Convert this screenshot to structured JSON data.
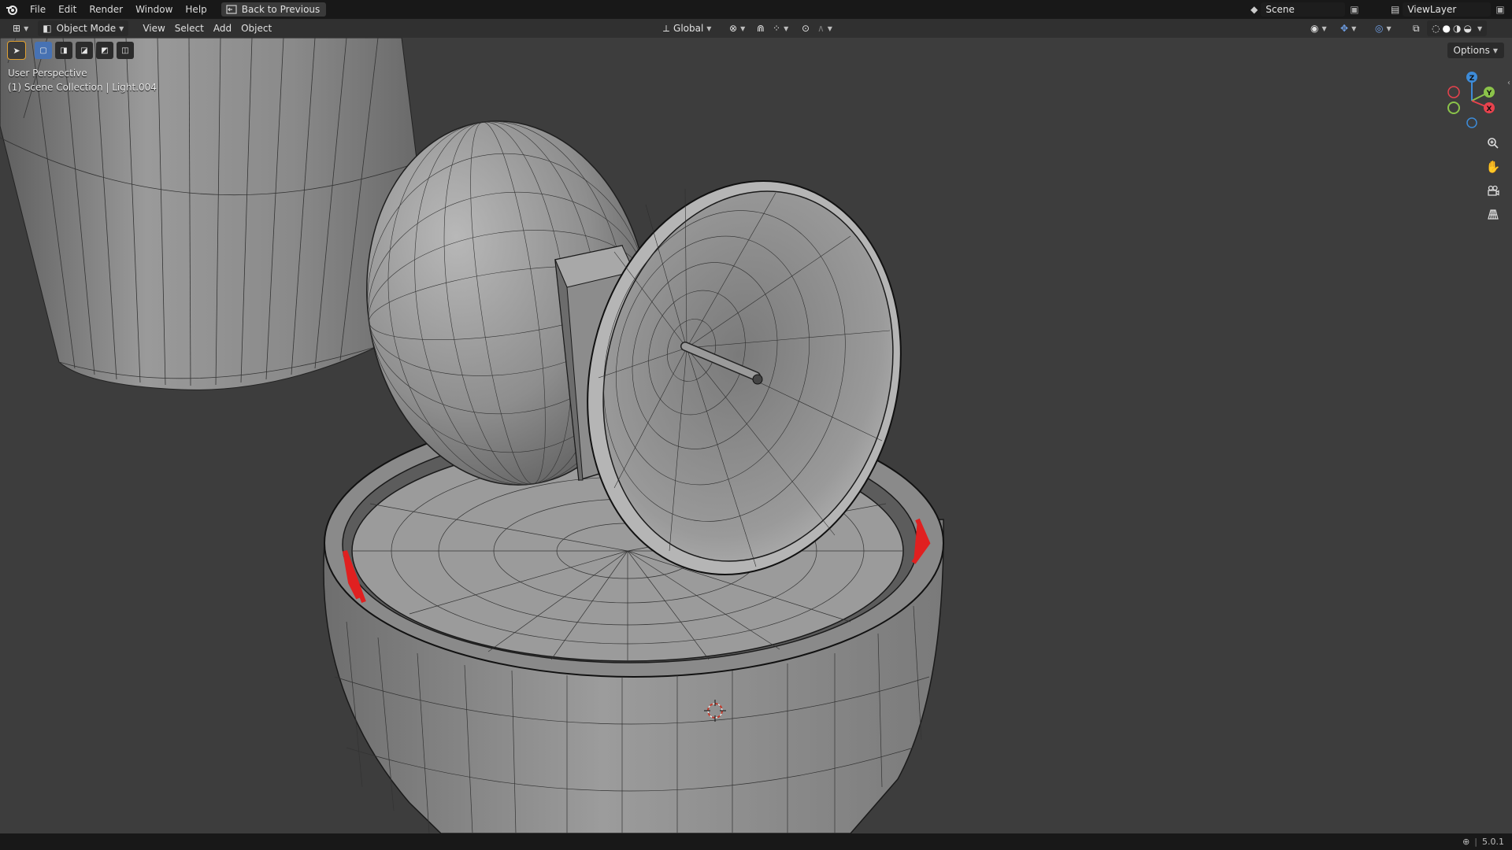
{
  "menu": {
    "items": [
      "File",
      "Edit",
      "Render",
      "Window",
      "Help"
    ],
    "back_label": "Back to Previous"
  },
  "top_right": {
    "scene": "Scene",
    "view_layer": "ViewLayer"
  },
  "header": {
    "mode": "Object Mode",
    "menus": [
      "View",
      "Select",
      "Add",
      "Object"
    ],
    "orientation": "Global"
  },
  "viewport": {
    "perspective": "User Perspective",
    "collection": "(1) Scene Collection | Light.004",
    "options_label": "Options"
  },
  "gizmo": {
    "x": "X",
    "y": "Y",
    "z": "Z"
  },
  "status": {
    "version": "5.0.1"
  },
  "colors": {
    "accent": "#4772b3",
    "background": "#3d3d3d",
    "x_axis": "#e8424d",
    "y_axis": "#8bc34a",
    "z_axis": "#3d8bd8",
    "error": "#e02020"
  },
  "icons": [
    "blender-logo-icon",
    "back-icon",
    "editor-type-icon",
    "object-mode-icon",
    "transform-orientation-icon",
    "pivot-icon",
    "snap-icon",
    "proportional-icon",
    "overlay-icon",
    "gizmo-icon",
    "xray-icon",
    "shading-icon",
    "zoom-icon",
    "pan-hand-icon",
    "camera-icon",
    "grid-icon",
    "scene-icon",
    "view-layer-icon",
    "globe-icon"
  ]
}
